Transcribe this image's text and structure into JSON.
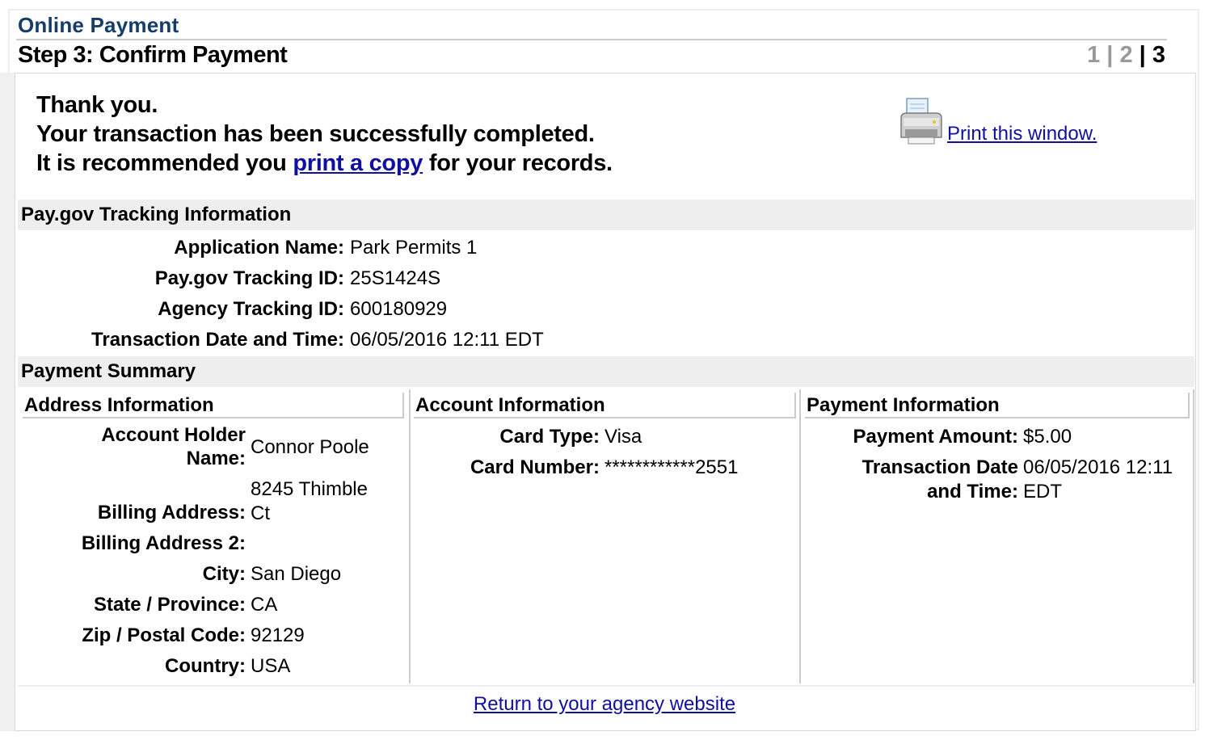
{
  "header": {
    "title": "Online Payment",
    "step_title": "Step 3: Confirm Payment",
    "steps": [
      "1",
      "2",
      "3"
    ],
    "step_sep": "|"
  },
  "thanks": {
    "line1": "Thank you.",
    "line2": "Your transaction has been successfully completed.",
    "line3_prefix": "It is recommended you ",
    "line3_link": "print a copy",
    "line3_suffix": " for your records."
  },
  "print": {
    "label": " Print this window.",
    "icon": "printer-icon"
  },
  "tracking": {
    "heading": "Pay.gov Tracking Information",
    "rows": [
      {
        "label": "Application Name:",
        "value": "Park Permits 1"
      },
      {
        "label": "Pay.gov Tracking ID:",
        "value": "25S1424S"
      },
      {
        "label": "Agency Tracking ID:",
        "value": "600180929"
      },
      {
        "label": "Transaction Date and Time:",
        "value": "06/05/2016 12:11 EDT"
      }
    ]
  },
  "summary": {
    "heading": "Payment Summary",
    "address": {
      "heading": "Address Information",
      "rows": [
        {
          "label1": "Account Holder",
          "label2": "Name:",
          "value": "Connor Poole"
        },
        {
          "label": "Billing Address:",
          "value1": "8245 Thimble",
          "value2": "Ct"
        },
        {
          "label": "Billing Address 2:",
          "value": ""
        },
        {
          "label": "City:",
          "value": "San Diego"
        },
        {
          "label": "State / Province:",
          "value": "CA"
        },
        {
          "label": "Zip / Postal Code:",
          "value": "92129"
        },
        {
          "label": "Country:",
          "value": "USA"
        }
      ]
    },
    "account": {
      "heading": "Account Information",
      "rows": [
        {
          "label": "Card Type:",
          "value": "Visa"
        },
        {
          "label": "Card Number:",
          "value": "************2551"
        }
      ]
    },
    "payment": {
      "heading": "Payment Information",
      "rows": [
        {
          "label": "Payment Amount:",
          "value": "$5.00"
        },
        {
          "label1": "Transaction Date",
          "label2": "and Time:",
          "value1": "06/05/2016 12:11",
          "value2": "EDT"
        }
      ]
    }
  },
  "footer": {
    "return_link": "Return to your agency website"
  }
}
